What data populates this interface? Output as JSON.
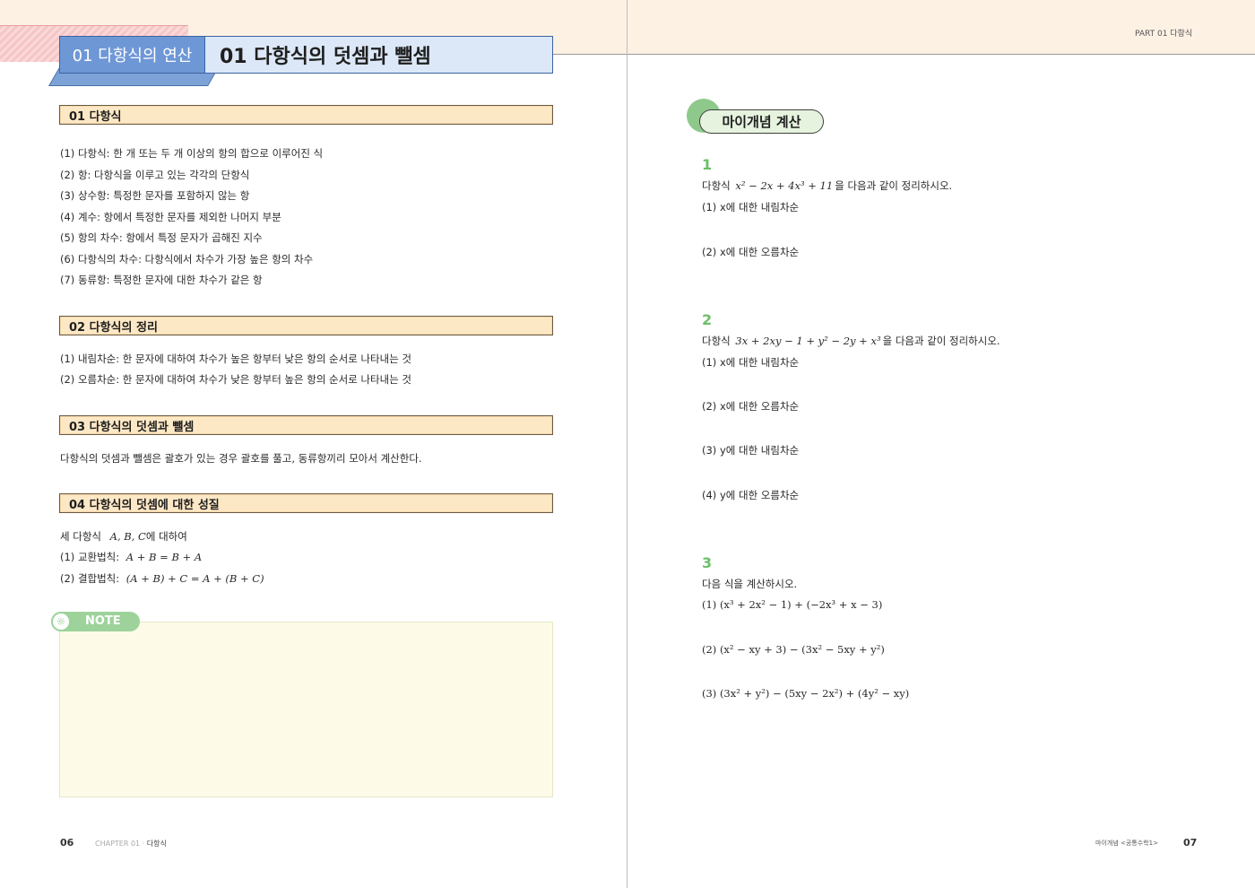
{
  "header": {
    "part_label": "PART 01 다항식"
  },
  "left_page": {
    "chapter_tab": "01 다항식의 연산",
    "title": "01 다항식의 덧셈과 뺄셈",
    "sections": [
      {
        "heading": "01 다항식",
        "lines": [
          "(1) 다항식: 한 개 또는 두 개 이상의 항의 합으로 이루어진 식",
          "(2) 항: 다항식을 이루고 있는 각각의 단항식",
          "(3) 상수항: 특정한 문자를 포함하지 않는 항",
          "(4) 계수: 항에서 특정한 문자를 제외한 나머지 부분",
          "(5) 항의 차수: 항에서 특정 문자가 곱해진 지수",
          "(6) 다항식의 차수: 다항식에서 차수가 가장 높은 항의 차수",
          "(7) 동류항: 특정한 문자에 대한 차수가 같은 항"
        ]
      },
      {
        "heading": "02 다항식의 정리",
        "lines": [
          "(1) 내림차순: 한 문자에 대하여 차수가 높은 항부터 낮은 항의 순서로 나타내는 것",
          "(2) 오름차순: 한 문자에 대하여 차수가 낮은 항부터 높은 항의 순서로 나타내는 것"
        ]
      },
      {
        "heading": "03 다항식의 덧셈과 뺄셈",
        "lines": [
          "다항식의 덧셈과 뺄셈은 괄호가 있는 경우 괄호를 풀고, 동류항끼리 모아서 계산한다."
        ]
      },
      {
        "heading": "04 다항식의 덧셈에 대한 성질",
        "lines": [
          "세 다항식",
          "(1) 교환법칙:",
          "(2) 결합법칙:"
        ],
        "math": {
          "vars": "A, B, C",
          "vars_suffix": "에 대하여",
          "commutative": "A + B = B + A",
          "associative": "(A + B) + C = A + (B + C)"
        }
      }
    ],
    "note_label": "NOTE",
    "footer": {
      "page_number": "06",
      "chapter": "CHAPTER 01 ·",
      "chapter_name": "다항식"
    }
  },
  "right_page": {
    "concept_label": "마이개념 계산",
    "problems": [
      {
        "number": "1",
        "prompt_prefix": "다항식",
        "expression": "x² − 2x + 4x³ + 11",
        "prompt_suffix": "을 다음과 같이 정리하시오.",
        "items": [
          "(1) x에 대한 내림차순",
          "(2) x에 대한 오름차순"
        ]
      },
      {
        "number": "2",
        "prompt_prefix": "다항식",
        "expression": "3x + 2xy − 1 + y² − 2y + x³",
        "prompt_suffix": "을 다음과 같이 정리하시오.",
        "items": [
          "(1) x에 대한 내림차순",
          "(2) x에 대한 오름차순",
          "(3) y에 대한 내림차순",
          "(4) y에 대한 오름차순"
        ]
      },
      {
        "number": "3",
        "prompt": "다음 식을 계산하시오.",
        "items": [
          "(1) (x³ + 2x² − 1) + (−2x³ + x − 3)",
          "(2) (x² − xy + 3) − (3x² − 5xy + y²)",
          "(3) (3x² + y²) − (5xy − 2x²) + (4y² − xy)"
        ]
      }
    ],
    "footer": {
      "book": "마이개념 <공통수학1>",
      "page_number": "07"
    }
  }
}
